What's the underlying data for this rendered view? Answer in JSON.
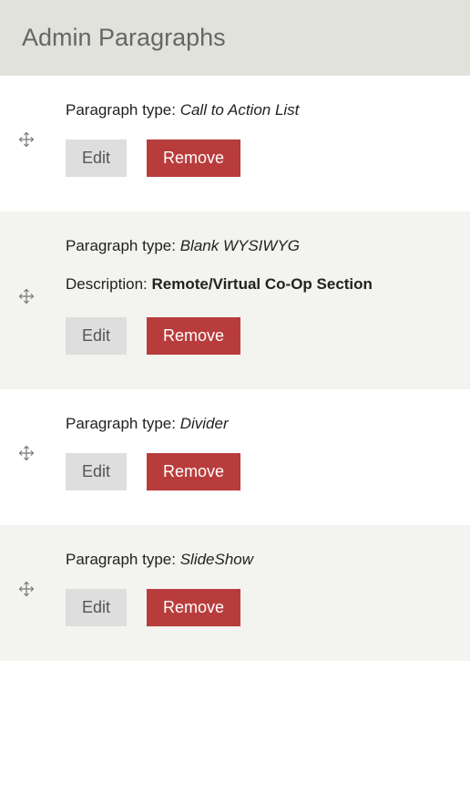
{
  "title": "Admin Paragraphs",
  "type_prefix": "Paragraph type: ",
  "desc_prefix": "Description: ",
  "buttons": {
    "edit": "Edit",
    "remove": "Remove"
  },
  "rows": [
    {
      "type": "Call to Action List",
      "alt": false
    },
    {
      "type": "Blank WYSIWYG",
      "description": "Remote/Virtual Co-Op Section",
      "alt": true
    },
    {
      "type": "Divider",
      "alt": false
    },
    {
      "type": "SlideShow",
      "alt": true
    }
  ]
}
